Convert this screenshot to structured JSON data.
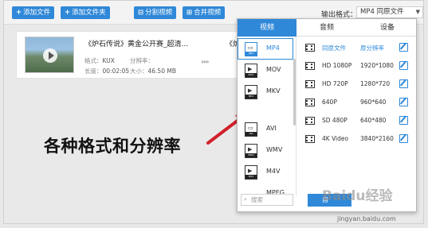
{
  "toolbar": {
    "add_file": "添加文件",
    "add_folder": "添加文件夹",
    "split_video": "分割视频",
    "merge_video": "合并视频",
    "output_format_label": "输出格式：",
    "output_format_value": "MP4  同原文件"
  },
  "file": {
    "name": "《炉石传说》黄金公开赛_超清...",
    "name2": "《炉",
    "format_label": "格式：",
    "format_value": "KUX",
    "resolution_label": "分辨率：",
    "resolution_value": "",
    "duration_label": "长度：",
    "duration_value": "00:02:05",
    "size_label": "大小：",
    "size_value": "46.50 MB"
  },
  "panel": {
    "tabs": [
      "视频",
      "音频",
      "设备"
    ],
    "active_tab": "视频",
    "formats": [
      "MP4",
      "MOV",
      "MKV",
      "AVI",
      "WMV",
      "M4V",
      "MPEG"
    ],
    "icon_bands": [
      "MP4",
      "MOV",
      "MKV",
      "AVI",
      "WMV",
      "M4V"
    ],
    "selected_format": "MP4",
    "search_placeholder": "搜索",
    "resolutions": [
      {
        "name": "同原文件",
        "value": "原分辨率"
      },
      {
        "name": "HD 1080P",
        "value": "1920*1080"
      },
      {
        "name": "HD 720P",
        "value": "1280*720"
      },
      {
        "name": "640P",
        "value": "960*640"
      },
      {
        "name": "SD 480P",
        "value": "640*480"
      },
      {
        "name": "4K Video",
        "value": "3840*2160"
      }
    ],
    "add_button": "自"
  },
  "annotation": "各种格式和分辨率",
  "watermark": {
    "logo": "Baidu经验",
    "url": "jingyan.baidu.com"
  },
  "colors": {
    "accent": "#2f88d8",
    "arrow": "#d0202a"
  }
}
